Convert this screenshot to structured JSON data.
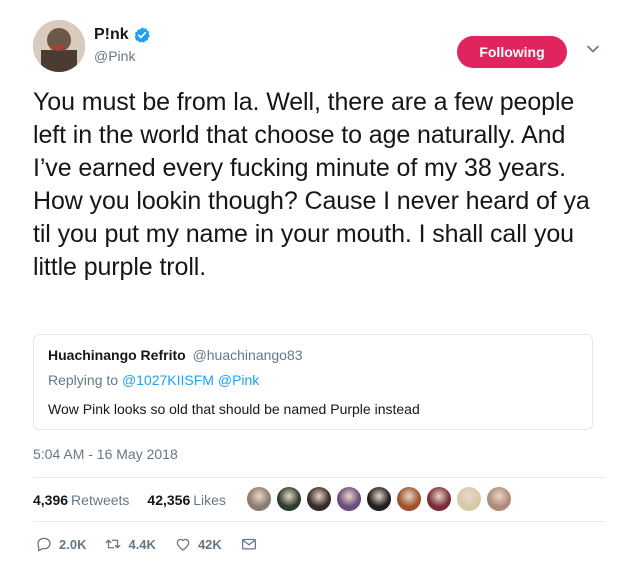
{
  "author": {
    "name": "P!nk",
    "handle": "@Pink",
    "avatar_colors": [
      "#f0e6dc",
      "#7a6a5a",
      "#c0392b"
    ]
  },
  "follow_button": {
    "label": "Following",
    "color": "#e0245e"
  },
  "tweet": {
    "text": "You must be from la. Well, there are a few people left in the world that choose to age naturally. And I’ve earned every fucking minute of my 38 years. How you lookin though? Cause I never heard of ya til you put my name in your mouth. I shall call you little purple troll.",
    "timestamp": "5:04 AM - 16 May 2018"
  },
  "quoted": {
    "name": "Huachinango Refrito",
    "handle": "@huachinango83",
    "replying_prefix": "Replying to",
    "replying_to": "@1027KIISFM @Pink",
    "text": "Wow Pink looks so old that should be named Purple instead"
  },
  "stats": {
    "retweets_count": "4,396",
    "retweets_label": "Retweets",
    "likes_count": "42,356",
    "likes_label": "Likes"
  },
  "likers": [
    {
      "color": "#8a7b6e"
    },
    {
      "color": "#2e3b2f"
    },
    {
      "color": "#3b2a2a"
    },
    {
      "color": "#6b4c7a"
    },
    {
      "color": "#1f1f1f"
    },
    {
      "color": "#a0522d"
    },
    {
      "color": "#7a2e3a"
    },
    {
      "color": "#d8c8a8"
    },
    {
      "color": "#b08a7a"
    }
  ],
  "actions": {
    "reply_count": "2.0K",
    "retweet_count": "4.4K",
    "like_count": "42K"
  },
  "icons": [
    "verified-icon",
    "chevron-down-icon",
    "reply-icon",
    "retweet-icon",
    "heart-icon",
    "message-icon"
  ]
}
